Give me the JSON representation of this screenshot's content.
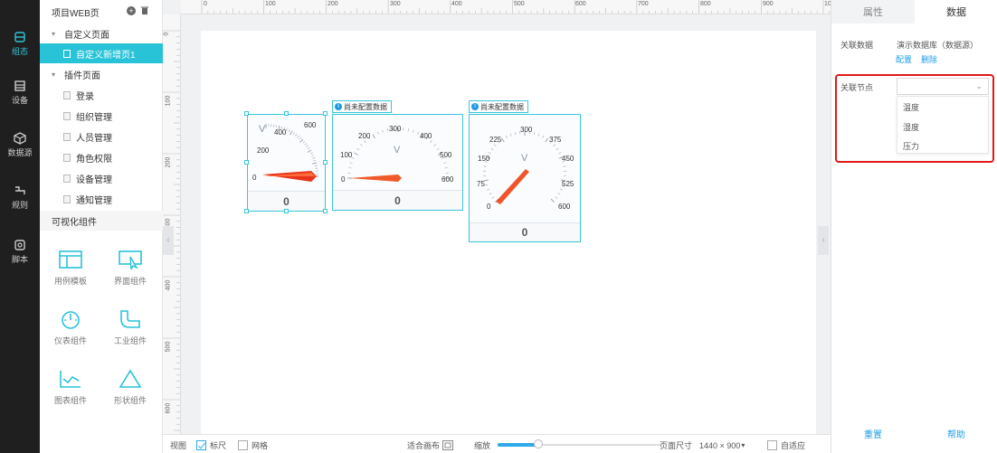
{
  "nav": {
    "items": [
      {
        "key": "zutai",
        "label": "组态",
        "icon": "layers-icon",
        "active": true
      },
      {
        "key": "device",
        "label": "设备",
        "icon": "device-icon",
        "active": false
      },
      {
        "key": "datasource",
        "label": "数据源",
        "icon": "cube-icon",
        "active": false
      },
      {
        "key": "rule",
        "label": "规则",
        "icon": "rule-icon",
        "active": false
      },
      {
        "key": "script",
        "label": "脚本",
        "icon": "script-icon",
        "active": false
      }
    ]
  },
  "tree": {
    "title": "项目WEB页",
    "custom_group": "自定义页面",
    "custom_pages": [
      "自定义新增页1"
    ],
    "plugin_group": "插件页面",
    "plugin_pages": [
      "登录",
      "组织管理",
      "人员管理",
      "角色权限",
      "设备管理",
      "通知管理"
    ],
    "components_section": "可视化组件",
    "components": [
      {
        "label": "用例模板",
        "icon": "template-icon"
      },
      {
        "label": "界面组件",
        "icon": "ui-component-icon"
      },
      {
        "label": "仪表组件",
        "icon": "gauge-icon"
      },
      {
        "label": "工业组件",
        "icon": "pipe-icon"
      },
      {
        "label": "图表组件",
        "icon": "chart-icon"
      },
      {
        "label": "形状组件",
        "icon": "triangle-icon"
      }
    ]
  },
  "rulers": {
    "top": [
      "0",
      "100",
      "200",
      "300",
      "400",
      "500",
      "600",
      "700",
      "800",
      "900",
      "10"
    ],
    "left": [
      "0",
      "100",
      "200",
      "300",
      "400",
      "500",
      "600"
    ]
  },
  "gauges": [
    {
      "unit": "V",
      "ticks": [
        "0",
        "200",
        "400",
        "600"
      ],
      "value": "0",
      "tag": ""
    },
    {
      "unit": "V",
      "ticks": [
        "0",
        "100",
        "200",
        "300",
        "400",
        "500",
        "600"
      ],
      "value": "0",
      "tag": "尚未配置数据"
    },
    {
      "unit": "V",
      "ticks": [
        "0",
        "75",
        "150",
        "225",
        "300",
        "375",
        "450",
        "525",
        "600"
      ],
      "value": "0",
      "tag": "尚未配置数据"
    }
  ],
  "statusbar": {
    "view": "视图",
    "ruler": "标尺",
    "ruler_checked": true,
    "grid": "网格",
    "grid_checked": false,
    "fit": "适合画布",
    "zoom": "缩放",
    "zoom_level": 0.25,
    "page_size_label": "页面尺寸",
    "page_size": "1440 × 900",
    "auto_fit": "自适应",
    "auto_fit_checked": false
  },
  "right": {
    "tabs": [
      "属性",
      "数据"
    ],
    "active_tab": "数据",
    "linked_data_label": "关联数据",
    "linked_data_value": "演示数据库（数据源）",
    "configure": "配置",
    "delete": "删除",
    "linked_node_label": "关联节点",
    "node_selected": "",
    "node_options": [
      "温度",
      "湿度",
      "压力"
    ],
    "reset": "重置",
    "help": "帮助",
    "colors": {
      "accent": "#29c3d8",
      "link": "#1c9ee6",
      "highlight": "#e01919"
    }
  }
}
